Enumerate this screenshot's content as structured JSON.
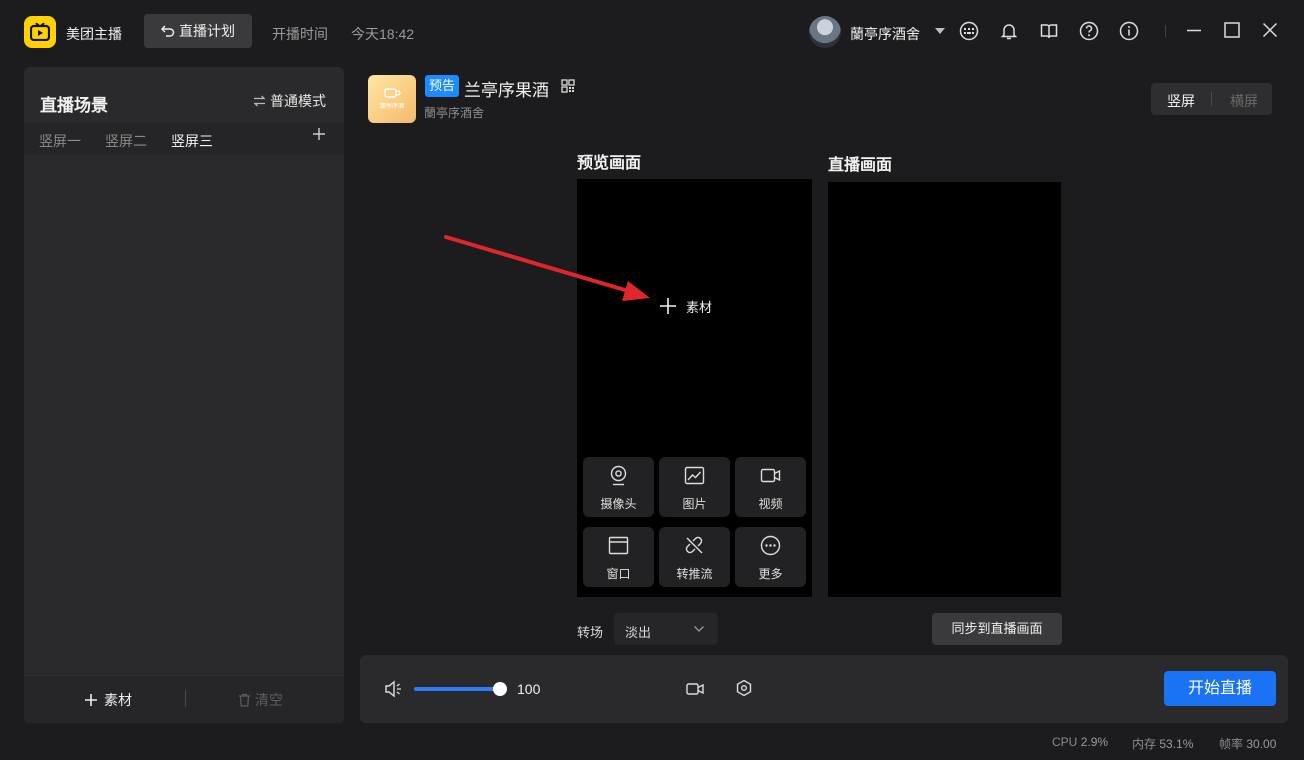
{
  "app": {
    "name": "美团主播",
    "plan_button": "直播计划",
    "start_time_label": "开播时间",
    "start_time_value": "今天18:42",
    "user_name": "蘭亭序酒舍"
  },
  "icons": {
    "logo": "tv-logo-icon",
    "back": "undo-arrow-icon",
    "keyboard": "keyboard-icon",
    "bell": "bell-icon",
    "book": "book-icon",
    "help": "help-icon",
    "info": "info-icon",
    "minimize": "minimize-icon",
    "maximize": "maximize-icon",
    "close": "close-icon"
  },
  "scene_panel": {
    "title": "直播场景",
    "mode_switch": "普通模式",
    "tabs": [
      {
        "label": "竖屏一",
        "active": false
      },
      {
        "label": "竖屏二",
        "active": false
      },
      {
        "label": "竖屏三",
        "active": true
      }
    ],
    "add_material": "素材",
    "clear": "清空"
  },
  "room": {
    "thumb_text": "蘭亭序酒",
    "badge": "预告",
    "title": "兰亭序果酒",
    "subtitle": "蘭亭序酒舍"
  },
  "orientation": {
    "portrait": "竖屏",
    "landscape": "横屏",
    "selected": "竖屏"
  },
  "preview": {
    "title": "预览画面",
    "add_material": "素材",
    "sources": [
      {
        "label": "摄像头",
        "icon": "camera-icon"
      },
      {
        "label": "图片",
        "icon": "image-icon"
      },
      {
        "label": "视频",
        "icon": "video-icon"
      },
      {
        "label": "窗口",
        "icon": "window-icon"
      },
      {
        "label": "转推流",
        "icon": "link-icon"
      },
      {
        "label": "更多",
        "icon": "more-icon"
      }
    ]
  },
  "live_view": {
    "title": "直播画面",
    "sync_button": "同步到直播画面"
  },
  "transition": {
    "label": "转场",
    "value": "淡出"
  },
  "controls": {
    "volume": "100",
    "volume_level": 1.0,
    "start_button": "开始直播"
  },
  "status": {
    "cpu_label": "CPU",
    "cpu_value": "2.9%",
    "mem_label": "内存",
    "mem_value": "53.1%",
    "fps_label": "帧率",
    "fps_value": "30.00"
  },
  "colors": {
    "accent": "#1a73f5",
    "brand": "#ffd100",
    "badge": "#1a8cff",
    "annotation_arrow": "#e0262b"
  }
}
